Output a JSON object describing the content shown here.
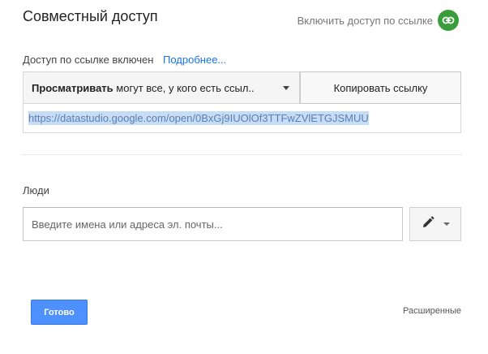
{
  "dialog": {
    "title": "Совместный доступ",
    "link_toggle_label": "Включить доступ по ссылке",
    "link_icon": "link-icon"
  },
  "link_access": {
    "status_text": "Доступ по ссылке включен",
    "more_link": "Подробнее...",
    "access_bold": "Просматривать",
    "access_rest": " могут все, у кого есть ссыл..",
    "copy_button": "Копировать ссылку",
    "url": "https://datastudio.google.com/open/0BxGj9IUOlOf3TTFwZVlETGJSMUU"
  },
  "people": {
    "label": "Люди",
    "input_placeholder": "Введите имена или адреса эл. почты...",
    "input_value": "",
    "permission_icon": "pencil-icon"
  },
  "footer": {
    "done_button": "Готово",
    "advanced_link": "Расширенные"
  },
  "colors": {
    "accent": "#4d90fe",
    "link": "#1a73e8",
    "link_toggle_icon_bg": "#3a9c3a",
    "url_selection": "#c7dcf5"
  }
}
